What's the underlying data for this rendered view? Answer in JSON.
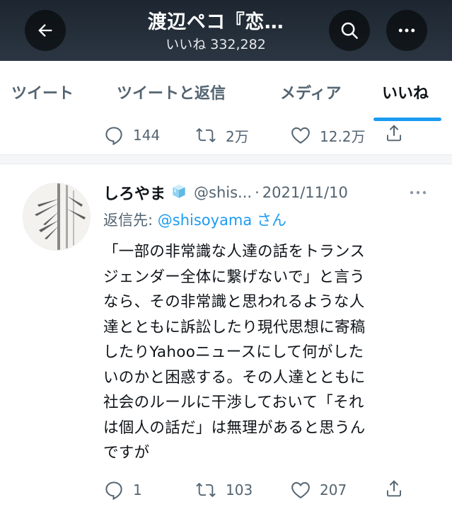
{
  "header": {
    "title": "渡辺ペコ『恋…",
    "subtitle": "いいね 332,282",
    "back_icon": "arrow-left-icon",
    "search_icon": "search-icon",
    "more_icon": "more-horizontal-icon"
  },
  "tabs": [
    {
      "label": "ツイート",
      "active": false
    },
    {
      "label": "ツイートと返信",
      "active": false
    },
    {
      "label": "メディア",
      "active": false
    },
    {
      "label": "いいね",
      "active": true
    }
  ],
  "accent_color": "#1d9bf0",
  "previous_tweet": {
    "replies": "144",
    "retweets": "2万",
    "likes": "12.2万"
  },
  "tweet": {
    "name": "しろやま",
    "handle": "@shis...",
    "separator": "·",
    "date": "2021/11/10",
    "reply_prefix": "返信先: ",
    "reply_mention": "@shisoyama",
    "reply_suffix": " さん",
    "lines": [
      "「一部の非常識な人達の話をトランス",
      "ジェンダー全体に繋げないで」と言う",
      "なら、その非常識と思われるような人",
      "達とともに訴訟したり現代思想に寄稿",
      "したりYahooニュースにして何がした",
      "いのかと困惑する。その人達とともに",
      "社会のルールに干渉しておいて「それ",
      "は個人の話だ」は無理があると思うん",
      "ですが"
    ],
    "replies": "1",
    "retweets": "103",
    "likes": "207"
  }
}
